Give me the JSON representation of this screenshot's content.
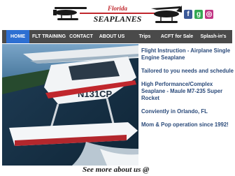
{
  "brand": {
    "title_line1": "Florida",
    "title_line2": "SEAPLANES"
  },
  "social": [
    {
      "glyph": "f",
      "icon": "facebook-icon"
    },
    {
      "glyph": "g",
      "icon": "google-plus-icon"
    },
    {
      "glyph": "◎",
      "icon": "instagram-icon"
    }
  ],
  "nav": {
    "items": [
      {
        "label": "HOME",
        "active": true
      },
      {
        "label": "FLT TRAINING"
      },
      {
        "label": "CONTACT"
      },
      {
        "label": "ABOUT US"
      },
      {
        "label": "Trips"
      },
      {
        "label": "ACFT for Sale"
      },
      {
        "label": "Splash-in's"
      }
    ]
  },
  "photo": {
    "tail_number": "N131CP"
  },
  "content": {
    "items": [
      "Flight Instruction - Airplane Single Engine Seaplane",
      "Tailored to you needs and schedule",
      "High Performance/Complex Seaplane - Maule M7-235 Super Rocket",
      "Conviently in Orlando, FL",
      "Mom & Pop operation since 1992!"
    ],
    "see_more": "See more about us @"
  },
  "colors": {
    "nav_bg": "#4a4a4a",
    "nav_active": "#2d6fd2",
    "text": "#2a4a7a"
  }
}
